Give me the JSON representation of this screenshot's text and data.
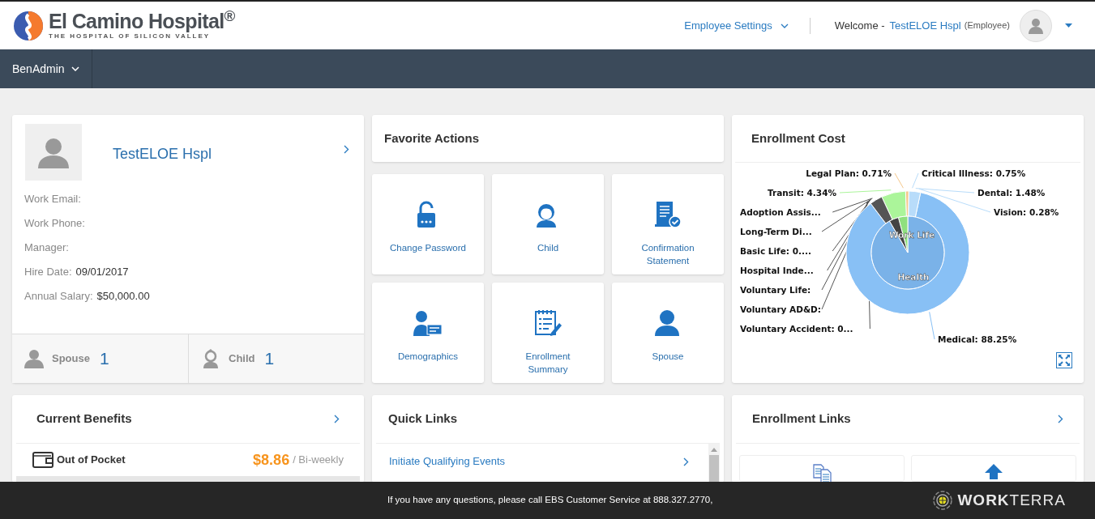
{
  "header": {
    "logo": {
      "name": "El Camino Hospital$^{®}$",
      "tagline": "THE HOSPITAL OF SILICON VALLEY"
    },
    "settings_menu": "Employee Settings",
    "welcome": "Welcome -",
    "user_name": "TestELOE Hspl",
    "user_role": "(Employee)"
  },
  "nav": [
    {
      "label": "BenAdmin"
    }
  ],
  "profile": {
    "name": "TestELOE Hspl",
    "fields": [
      {
        "label": "Work Email:"
      },
      {
        "label": "Work Phone:"
      },
      {
        "label": "Manager:"
      },
      {
        "label": "Hire Date:",
        "value": "09/01/2017"
      },
      {
        "label": "Annual Salary:",
        "value": "$50,000.00"
      }
    ],
    "dependents": [
      {
        "kind": "spouse",
        "label": "Spouse",
        "count": "1"
      },
      {
        "kind": "child",
        "label": "Child",
        "count": "1"
      }
    ]
  },
  "favorite_actions": {
    "title": "Favorite Actions",
    "items": [
      {
        "kind": "lock",
        "label": "Change Password"
      },
      {
        "kind": "child",
        "label": "Child"
      },
      {
        "kind": "document",
        "label": "Confirmation Statement"
      },
      {
        "kind": "idcard",
        "label": "Demographics"
      },
      {
        "kind": "summary",
        "label": "Enrollment Summary"
      },
      {
        "kind": "person",
        "label": "Spouse"
      }
    ]
  },
  "enrollment_cost": {
    "title": "Enrollment Cost",
    "ring_labels": [
      "Work Life",
      "Health"
    ],
    "slice_labels": [
      {
        "text": "Legal Plan: 0.71%"
      },
      {
        "text": "Critical Illness: 0.75%"
      },
      {
        "text": "Transit: 4.34%"
      },
      {
        "text": "Dental: 1.48%"
      },
      {
        "text": "Vision: 0.28%"
      },
      {
        "text": "Adoption Assis..."
      },
      {
        "text": "Long-Term Di..."
      },
      {
        "text": "Basic Life: 0...."
      },
      {
        "text": "Hospital Inde..."
      },
      {
        "text": "Voluntary Life:"
      },
      {
        "text": "Voluntary AD&D:"
      },
      {
        "text": "Voluntary Accident: 0..."
      },
      {
        "text": "Medical: 88.25%"
      }
    ]
  },
  "current_benefits": {
    "title": "Current Benefits",
    "rows": [
      {
        "label": "Out of Pocket",
        "amount": "$8.86",
        "period": "/ Bi-weekly"
      }
    ]
  },
  "quick_links": {
    "title": "Quick Links",
    "items": [
      "Initiate Qualifying Events"
    ]
  },
  "enrollment_links": {
    "title": "Enrollment Links",
    "tiles": [
      {
        "kind": "documents"
      },
      {
        "kind": "upload"
      }
    ]
  },
  "footer": {
    "message": "If you have any questions, please call EBS Customer Service at 888.327.2770,",
    "brand": "**WORK**TERRA"
  }
}
